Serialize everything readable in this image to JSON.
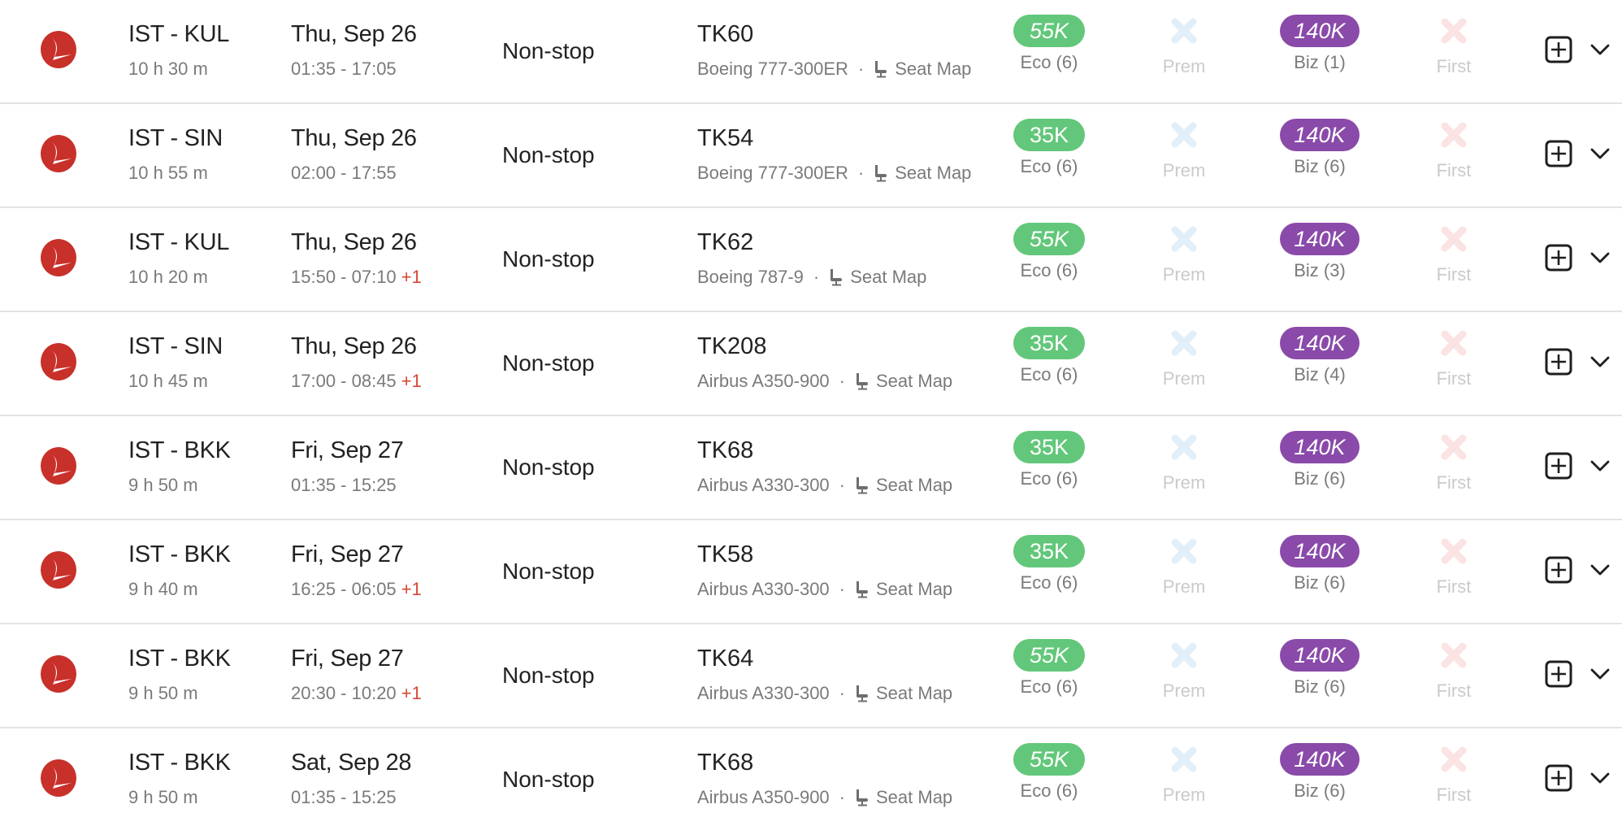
{
  "colors": {
    "eco_badge": "#62c77a",
    "biz_badge": "#8a4aa9",
    "prem_unavailable_x": "#e2eef8",
    "first_unavailable_x": "#fbe3e3",
    "plus_day": "#d64534",
    "airline_logo": "#c8302a"
  },
  "icons": {
    "airline": "turkish-airlines-logo",
    "seat": "seat-icon",
    "unavailable": "x-icon",
    "add": "plus-square-icon",
    "expand": "chevron-down-icon"
  },
  "flights": [
    {
      "route": "IST - KUL",
      "duration": "10 h 30 m",
      "date": "Thu, Sep 26",
      "times": "01:35 - 17:05",
      "plus_day": "",
      "stops": "Non-stop",
      "flight_no": "TK60",
      "aircraft": "Boeing 777-300ER",
      "separator": "·",
      "seat_map": "Seat Map",
      "eco": {
        "price": "55K",
        "label": "Eco (6)",
        "italic": true
      },
      "prem": {
        "label": "Prem",
        "available": false
      },
      "biz": {
        "price": "140K",
        "label": "Biz (1)",
        "italic": true
      },
      "first": {
        "label": "First",
        "available": false
      }
    },
    {
      "route": "IST - SIN",
      "duration": "10 h 55 m",
      "date": "Thu, Sep 26",
      "times": "02:00 - 17:55",
      "plus_day": "",
      "stops": "Non-stop",
      "flight_no": "TK54",
      "aircraft": "Boeing 777-300ER",
      "separator": "·",
      "seat_map": "Seat Map",
      "eco": {
        "price": "35K",
        "label": "Eco (6)",
        "italic": false
      },
      "prem": {
        "label": "Prem",
        "available": false
      },
      "biz": {
        "price": "140K",
        "label": "Biz (6)",
        "italic": true
      },
      "first": {
        "label": "First",
        "available": false
      }
    },
    {
      "route": "IST - KUL",
      "duration": "10 h 20 m",
      "date": "Thu, Sep 26",
      "times": "15:50 - 07:10",
      "plus_day": "+1",
      "stops": "Non-stop",
      "flight_no": "TK62",
      "aircraft": "Boeing 787-9",
      "separator": "·",
      "seat_map": "Seat Map",
      "eco": {
        "price": "55K",
        "label": "Eco (6)",
        "italic": true
      },
      "prem": {
        "label": "Prem",
        "available": false
      },
      "biz": {
        "price": "140K",
        "label": "Biz (3)",
        "italic": true
      },
      "first": {
        "label": "First",
        "available": false
      }
    },
    {
      "route": "IST - SIN",
      "duration": "10 h 45 m",
      "date": "Thu, Sep 26",
      "times": "17:00 - 08:45",
      "plus_day": "+1",
      "stops": "Non-stop",
      "flight_no": "TK208",
      "aircraft": "Airbus A350-900",
      "separator": "·",
      "seat_map": "Seat Map",
      "eco": {
        "price": "35K",
        "label": "Eco (6)",
        "italic": false
      },
      "prem": {
        "label": "Prem",
        "available": false
      },
      "biz": {
        "price": "140K",
        "label": "Biz (4)",
        "italic": true
      },
      "first": {
        "label": "First",
        "available": false
      }
    },
    {
      "route": "IST - BKK",
      "duration": "9 h 50 m",
      "date": "Fri, Sep 27",
      "times": "01:35 - 15:25",
      "plus_day": "",
      "stops": "Non-stop",
      "flight_no": "TK68",
      "aircraft": "Airbus A330-300",
      "separator": "·",
      "seat_map": "Seat Map",
      "eco": {
        "price": "35K",
        "label": "Eco (6)",
        "italic": false
      },
      "prem": {
        "label": "Prem",
        "available": false
      },
      "biz": {
        "price": "140K",
        "label": "Biz (6)",
        "italic": true
      },
      "first": {
        "label": "First",
        "available": false
      }
    },
    {
      "route": "IST - BKK",
      "duration": "9 h 40 m",
      "date": "Fri, Sep 27",
      "times": "16:25 - 06:05",
      "plus_day": "+1",
      "stops": "Non-stop",
      "flight_no": "TK58",
      "aircraft": "Airbus A330-300",
      "separator": "·",
      "seat_map": "Seat Map",
      "eco": {
        "price": "35K",
        "label": "Eco (6)",
        "italic": false
      },
      "prem": {
        "label": "Prem",
        "available": false
      },
      "biz": {
        "price": "140K",
        "label": "Biz (6)",
        "italic": true
      },
      "first": {
        "label": "First",
        "available": false
      }
    },
    {
      "route": "IST - BKK",
      "duration": "9 h 50 m",
      "date": "Fri, Sep 27",
      "times": "20:30 - 10:20",
      "plus_day": "+1",
      "stops": "Non-stop",
      "flight_no": "TK64",
      "aircraft": "Airbus A330-300",
      "separator": "·",
      "seat_map": "Seat Map",
      "eco": {
        "price": "55K",
        "label": "Eco (6)",
        "italic": true
      },
      "prem": {
        "label": "Prem",
        "available": false
      },
      "biz": {
        "price": "140K",
        "label": "Biz (6)",
        "italic": true
      },
      "first": {
        "label": "First",
        "available": false
      }
    },
    {
      "route": "IST - BKK",
      "duration": "9 h 50 m",
      "date": "Sat, Sep 28",
      "times": "01:35 - 15:25",
      "plus_day": "",
      "stops": "Non-stop",
      "flight_no": "TK68",
      "aircraft": "Airbus A350-900",
      "separator": "·",
      "seat_map": "Seat Map",
      "eco": {
        "price": "55K",
        "label": "Eco (6)",
        "italic": true
      },
      "prem": {
        "label": "Prem",
        "available": false
      },
      "biz": {
        "price": "140K",
        "label": "Biz (6)",
        "italic": true
      },
      "first": {
        "label": "First",
        "available": false
      }
    }
  ]
}
